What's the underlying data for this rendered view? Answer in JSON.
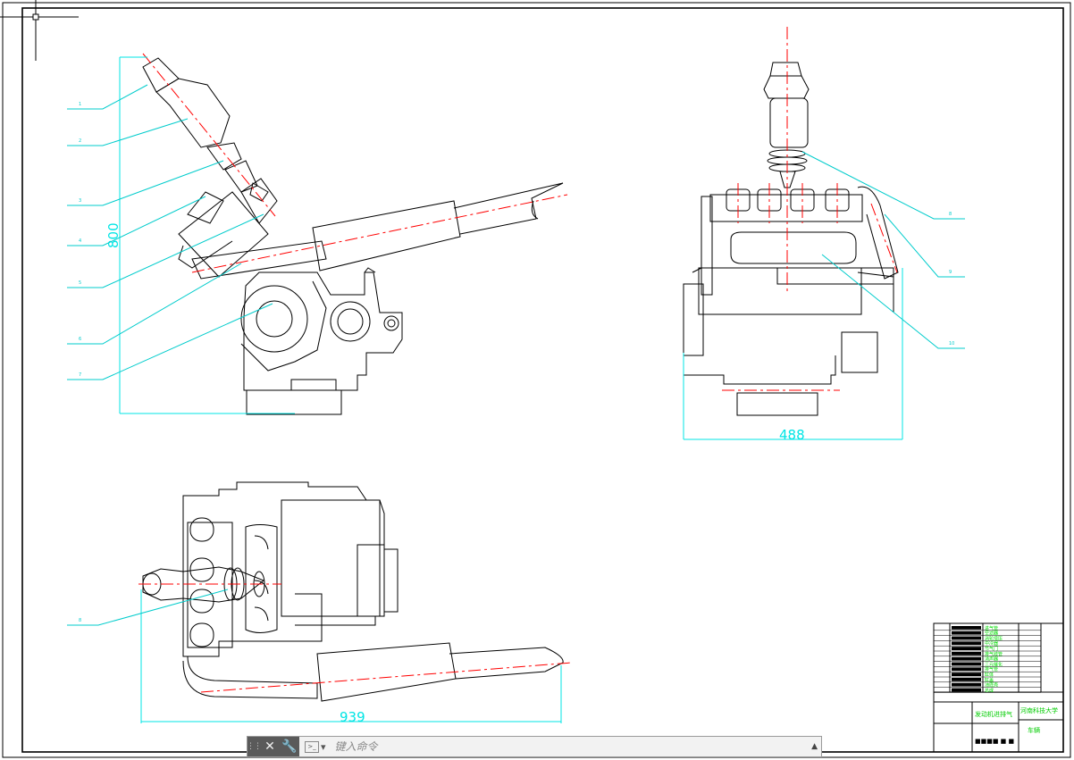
{
  "dimensions": {
    "height": "800",
    "width": "488",
    "length": "939"
  },
  "leaders": {
    "front": [
      "1",
      "2",
      "3",
      "4",
      "5",
      "6",
      "7"
    ],
    "side": [
      "8",
      "9",
      "10"
    ],
    "top": [
      "8"
    ]
  },
  "title_block": {
    "drawing_name": "发动机进排气",
    "school": "河南科技大学",
    "class": "车辆",
    "row_fill": "■■■■ ■ ■",
    "row_texts": [
      "进气管",
      "空滤器",
      "涡轮增压",
      "中冷器",
      "节气门",
      "排气歧管",
      "消声器",
      "三元催化",
      "排气管",
      "缸体",
      "缸盖",
      "油底壳",
      "总成"
    ]
  },
  "command_line": {
    "close_icon": "close-icon",
    "settings_icon": "wrench-icon",
    "placeholder": "键入命令"
  },
  "colors": {
    "line": "#000000",
    "center_line": "#ff0000",
    "dimension": "#00e5e5",
    "title_green": "#00dd00",
    "border": "#000000"
  }
}
